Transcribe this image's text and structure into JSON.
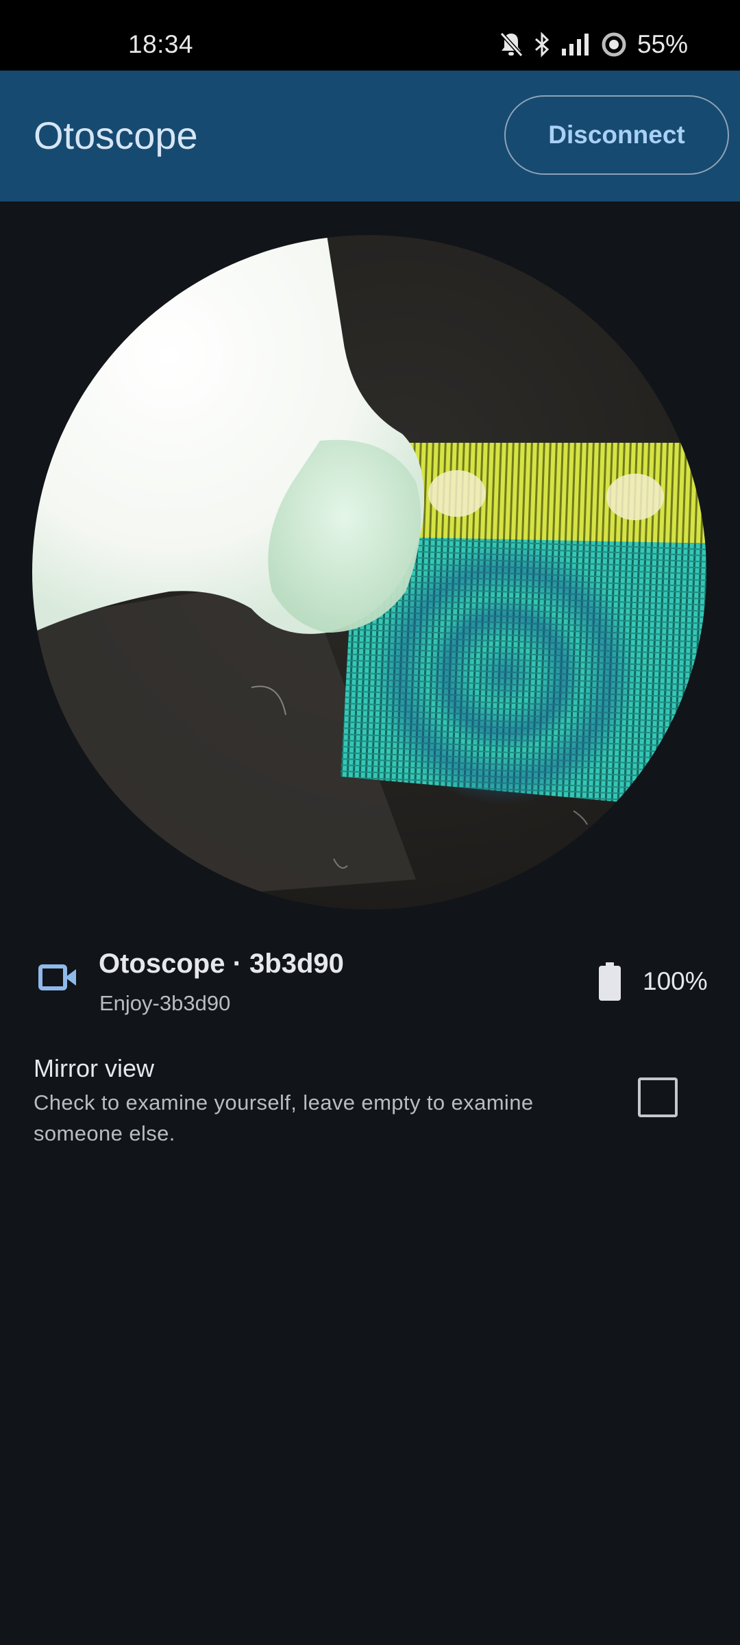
{
  "status_bar": {
    "time": "18:34",
    "battery": "55%",
    "icons": [
      "bell-off-icon",
      "bluetooth-icon",
      "signal-icon",
      "data-saver-icon"
    ]
  },
  "app_bar": {
    "title": "Otoscope",
    "disconnect_label": "Disconnect",
    "background_color": "#174a70",
    "accent_color": "#a9d0f5"
  },
  "camera": {
    "view": "live-otoscope-feed"
  },
  "device": {
    "name": "Otoscope · 3b3d90",
    "network": "Enjoy-3b3d90",
    "battery": "100%",
    "battery_level": 1.0,
    "icon": "video-camera-icon"
  },
  "mirror": {
    "title": "Mirror view",
    "description": "Check to examine yourself, leave empty to examine someone else.",
    "checked": false
  }
}
